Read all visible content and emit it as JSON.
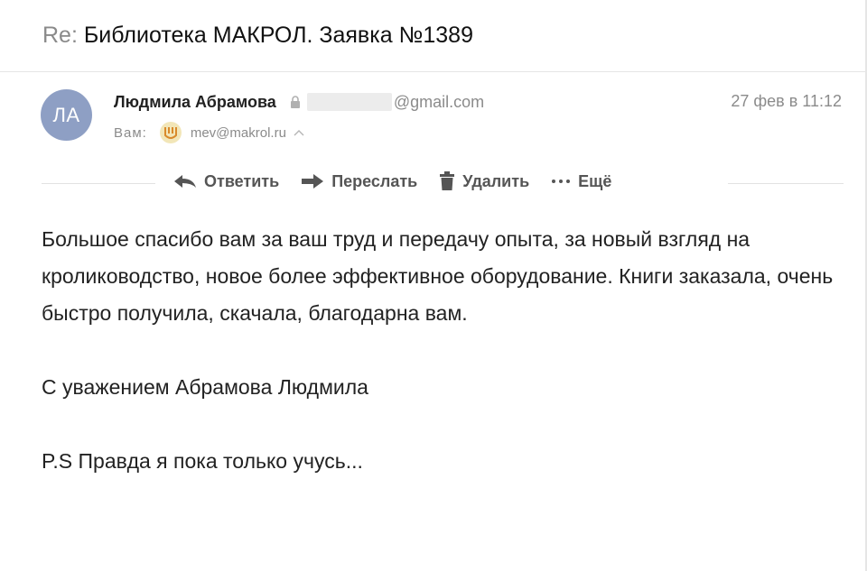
{
  "subject": {
    "prefix": "Re:",
    "text": "Библиотека МАКРОЛ. Заявка №1389"
  },
  "sender": {
    "initials": "ЛА",
    "name": "Людмила Абрамова",
    "email_domain": "@gmail.com",
    "date": "27 фев в 11:12"
  },
  "recipient": {
    "label": "Вам:",
    "email": "mev@makrol.ru"
  },
  "actions": {
    "reply": "Ответить",
    "forward": "Переслать",
    "delete": "Удалить",
    "more": "Ещё"
  },
  "body": {
    "paragraph1": "Большое спасибо вам за ваш труд и передачу опыта, за новый взгляд на кролиководство, новое более эффективное оборудование. Книги заказала, очень быстро получила, скачала, благодарна вам.",
    "signature": "С уважением Абрамова Людмила",
    "ps": "P.S Правда я пока только учусь..."
  },
  "colors": {
    "avatar_bg": "#8e9fc4",
    "muted_text": "#8b8b8b"
  },
  "icons": [
    "lock-icon",
    "recipient-avatar",
    "chevron-up-icon",
    "reply-icon",
    "forward-icon",
    "trash-icon",
    "more-icon"
  ]
}
